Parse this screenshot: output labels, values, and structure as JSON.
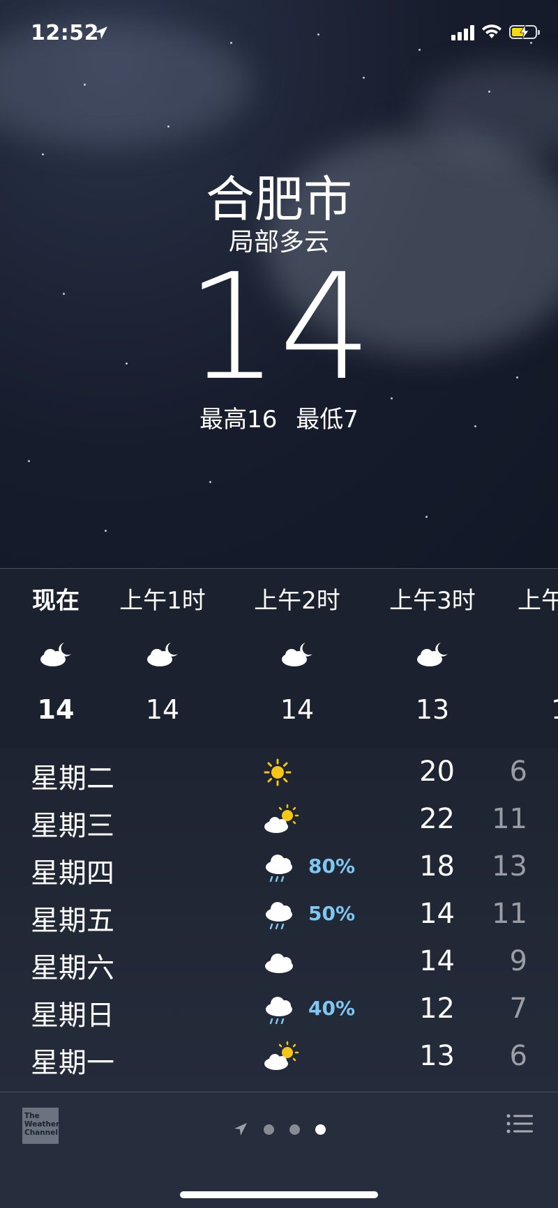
{
  "status_bar": {
    "time": "12:52"
  },
  "current": {
    "city": "合肥市",
    "condition": "局部多云",
    "temperature": "14",
    "high": "最高16",
    "low": "最低7"
  },
  "hourly": [
    {
      "label": "现在",
      "icon": "partly-cloudy-night-icon",
      "temp": "14"
    },
    {
      "label": "上午1时",
      "icon": "partly-cloudy-night-icon",
      "temp": "14"
    },
    {
      "label": "上午2时",
      "icon": "partly-cloudy-night-icon",
      "temp": "14"
    },
    {
      "label": "上午3时",
      "icon": "partly-cloudy-night-icon",
      "temp": "13"
    },
    {
      "label": "上午",
      "icon": "partly-cloudy-night-icon",
      "temp": "1"
    }
  ],
  "daily": [
    {
      "day": "星期二",
      "icon": "sun-icon",
      "precip": "",
      "high": "20",
      "low": "6"
    },
    {
      "day": "星期三",
      "icon": "partly-sunny-icon",
      "precip": "",
      "high": "22",
      "low": "11"
    },
    {
      "day": "星期四",
      "icon": "rain-icon",
      "precip": "80%",
      "high": "18",
      "low": "13"
    },
    {
      "day": "星期五",
      "icon": "rain-icon",
      "precip": "50%",
      "high": "14",
      "low": "11"
    },
    {
      "day": "星期六",
      "icon": "cloud-icon",
      "precip": "",
      "high": "14",
      "low": "9"
    },
    {
      "day": "星期日",
      "icon": "rain-icon",
      "precip": "40%",
      "high": "12",
      "low": "7"
    },
    {
      "day": "星期一",
      "icon": "partly-sunny-icon",
      "precip": "",
      "high": "13",
      "low": "6"
    }
  ],
  "toolbar": {
    "logo_text": "The Weather Channel",
    "pages": 3,
    "active_page": 3
  },
  "colors": {
    "accent_precip": "#7fc6f0",
    "sun": "#f5c518",
    "battery_charging": "#f5d90a"
  }
}
